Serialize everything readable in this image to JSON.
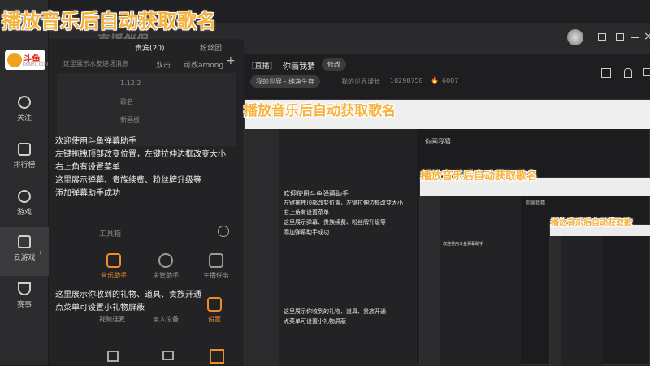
{
  "overlay_title": "播放音乐后自动获取歌名",
  "overlay_title_short": "播放音乐后自动获取歌",
  "brand": {
    "name": "斗鱼",
    "domain": "DOUYU.COM",
    "app": "直播伴侣"
  },
  "sidebar": {
    "items": [
      {
        "label": "关注"
      },
      {
        "label": "排行榜"
      },
      {
        "label": "游戏"
      },
      {
        "label": "云游戏"
      },
      {
        "label": "赛事"
      }
    ]
  },
  "panel": {
    "tabs": [
      "贵宾(20)",
      "粉丝团"
    ],
    "subtabs": [
      "双击",
      "可改among"
    ],
    "welcome_msg_area": "这里展示水友进场消息",
    "scene_items": [
      "1.12.2",
      "歌名",
      "新画板"
    ],
    "welcome": [
      "欢迎使用斗鱼弹幕助手",
      "左键拖拽顶部改变位置，左键拉伸边框改变大小",
      "右上角有设置菜单",
      "这里展示弹幕、贵族续费、粉丝牌升级等",
      "添加弹幕助手成功"
    ],
    "toolbox": "工具箱",
    "tools": [
      "音乐助手",
      "房管助手",
      "主播任务"
    ],
    "gift_msg": [
      "这里展示你收到的礼物、道具、贵族开通",
      "点菜单可设置小礼物屏蔽"
    ],
    "bottom_tools": [
      "视频连麦",
      "录入设备",
      "设置"
    ]
  },
  "live": {
    "status": "[直播]",
    "title": "你画我猜",
    "edit": "修改",
    "world": "我的世界 - 纯净生存",
    "growth_label": "我的世界漫长",
    "room_id": "10298758",
    "hot": "6087"
  }
}
